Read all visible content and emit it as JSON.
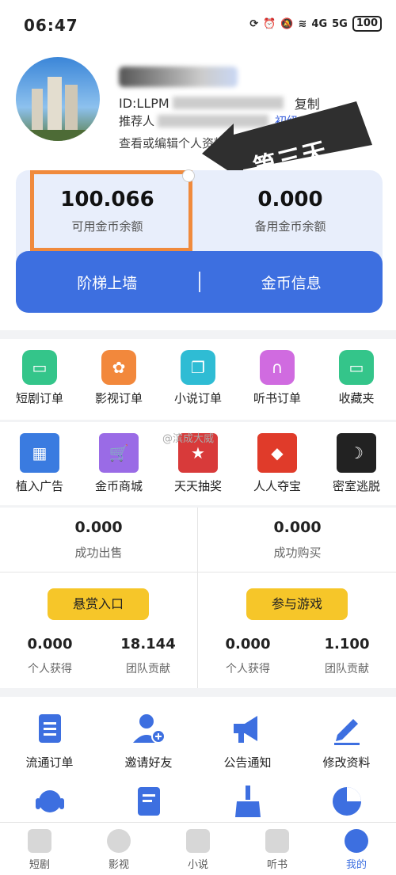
{
  "status": {
    "time": "06:47",
    "battery": "100",
    "signal_4g": "4G",
    "signal_5g": "5G"
  },
  "profile": {
    "id_prefix": "ID:LLPM",
    "copy_label": "复制",
    "ref_prefix": "推荐人",
    "level": "初级",
    "edit_link": "查看或编辑个人资料 >"
  },
  "annotation": {
    "label": "第三天"
  },
  "balance": {
    "available_value": "100.066",
    "available_label": "可用金币余额",
    "reserve_value": "0.000",
    "reserve_label": "备用金币余额",
    "btn_ladder": "阶梯上墙",
    "btn_coin_info": "金币信息"
  },
  "orders": [
    {
      "label": "短剧订单",
      "icon": "tv-icon",
      "color": "#34c58a"
    },
    {
      "label": "影视订单",
      "icon": "film-reel-icon",
      "color": "#f2883c"
    },
    {
      "label": "小说订单",
      "icon": "book-icon",
      "color": "#2fbcd4"
    },
    {
      "label": "听书订单",
      "icon": "headphones-icon",
      "color": "#d06be0"
    },
    {
      "label": "收藏夹",
      "icon": "tv-icon",
      "color": "#34c58a"
    }
  ],
  "apps": [
    {
      "label": "植入广告",
      "icon": "ad-placement-icon",
      "color": "#3a7be0"
    },
    {
      "label": "金币商城",
      "icon": "shopping-cart-icon",
      "color": "#9a6be6"
    },
    {
      "label": "天天抽奖",
      "icon": "lottery-icon",
      "color": "#d83a3a"
    },
    {
      "label": "人人夺宝",
      "icon": "treasure-bag-icon",
      "color": "#e03b2a"
    },
    {
      "label": "密室逃脱",
      "icon": "escape-room-icon",
      "color": "#222222"
    }
  ],
  "watermark": "@滨成大威",
  "stats": {
    "sold_value": "0.000",
    "sold_label": "成功出售",
    "bought_value": "0.000",
    "bought_label": "成功购买",
    "reward_btn": "悬赏入口",
    "game_btn": "参与游戏",
    "left_personal_value": "0.000",
    "left_personal_label": "个人获得",
    "left_team_value": "18.144",
    "left_team_label": "团队贡献",
    "right_personal_value": "0.000",
    "right_personal_label": "个人获得",
    "right_team_value": "1.100",
    "right_team_label": "团队贡献"
  },
  "tools": [
    {
      "label": "流通订单",
      "icon": "clipboard-icon"
    },
    {
      "label": "邀请好友",
      "icon": "add-user-icon"
    },
    {
      "label": "公告通知",
      "icon": "megaphone-icon"
    },
    {
      "label": "修改资料",
      "icon": "pencil-icon"
    }
  ],
  "tools_row2": [
    {
      "icon": "customer-service-icon"
    },
    {
      "icon": "document-edit-icon"
    },
    {
      "icon": "broom-icon"
    },
    {
      "icon": "pie-chart-icon"
    }
  ],
  "tabs": [
    {
      "label": "短剧",
      "icon": "tv-icon"
    },
    {
      "label": "影视",
      "icon": "film-reel-icon"
    },
    {
      "label": "小说",
      "icon": "book-icon"
    },
    {
      "label": "听书",
      "icon": "audio-book-icon"
    },
    {
      "label": "我的",
      "icon": "user-icon",
      "active": true
    }
  ],
  "colors": {
    "primary": "#3d6fe0",
    "yellow": "#f6c629",
    "highlight": "#f08a3c"
  }
}
